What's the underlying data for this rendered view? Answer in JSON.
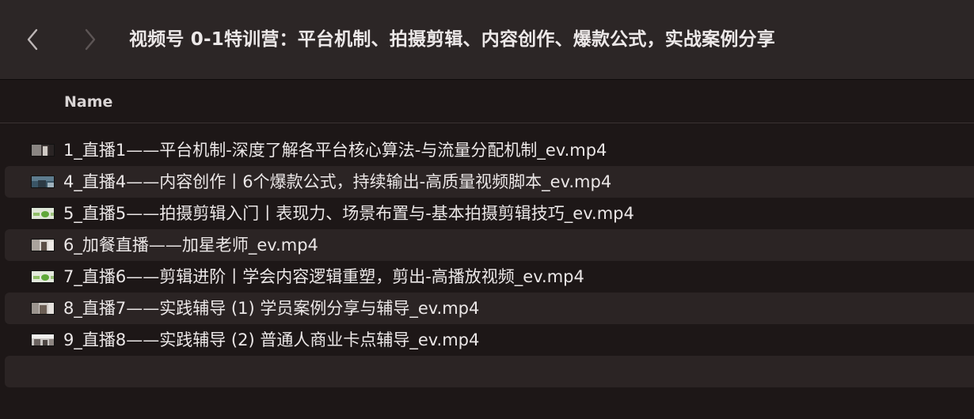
{
  "window": {
    "title": "视频号 0-1特训营：平台机制、拍摄剪辑、内容创作、爆款公式，实战案例分享"
  },
  "toolbar": {
    "back_icon": "chevron-left-icon",
    "forward_icon": "chevron-right-icon"
  },
  "columns": {
    "name": "Name"
  },
  "files": [
    {
      "name": "1_直播1——平台机制-深度了解各平台核心算法-与流量分配机制_ev.mp4",
      "thumb": "video-thumbnail-icon"
    },
    {
      "name": "4_直播4——内容创作丨6个爆款公式，持续输出-高质量视频脚本_ev.mp4",
      "thumb": "video-thumbnail-icon"
    },
    {
      "name": "5_直播5——拍摄剪辑入门丨表现力、场景布置与-基本拍摄剪辑技巧_ev.mp4",
      "thumb": "video-thumbnail-icon"
    },
    {
      "name": "6_加餐直播——加星老师_ev.mp4",
      "thumb": "video-thumbnail-icon"
    },
    {
      "name": "7_直播6——剪辑进阶丨学会内容逻辑重塑，剪出-高播放视频_ev.mp4",
      "thumb": "video-thumbnail-icon"
    },
    {
      "name": "8_直播7——实践辅导 (1) 学员案例分享与辅导_ev.mp4",
      "thumb": "video-thumbnail-icon"
    },
    {
      "name": "9_直播8——实践辅导 (2) 普通人商业卡点辅导_ev.mp4",
      "thumb": "video-thumbnail-icon"
    }
  ],
  "colors": {
    "toolbar_bg": "#2c2626",
    "window_bg": "#1d1717",
    "row_alt_bg": "#2b2424",
    "text": "#ebe7e7"
  }
}
